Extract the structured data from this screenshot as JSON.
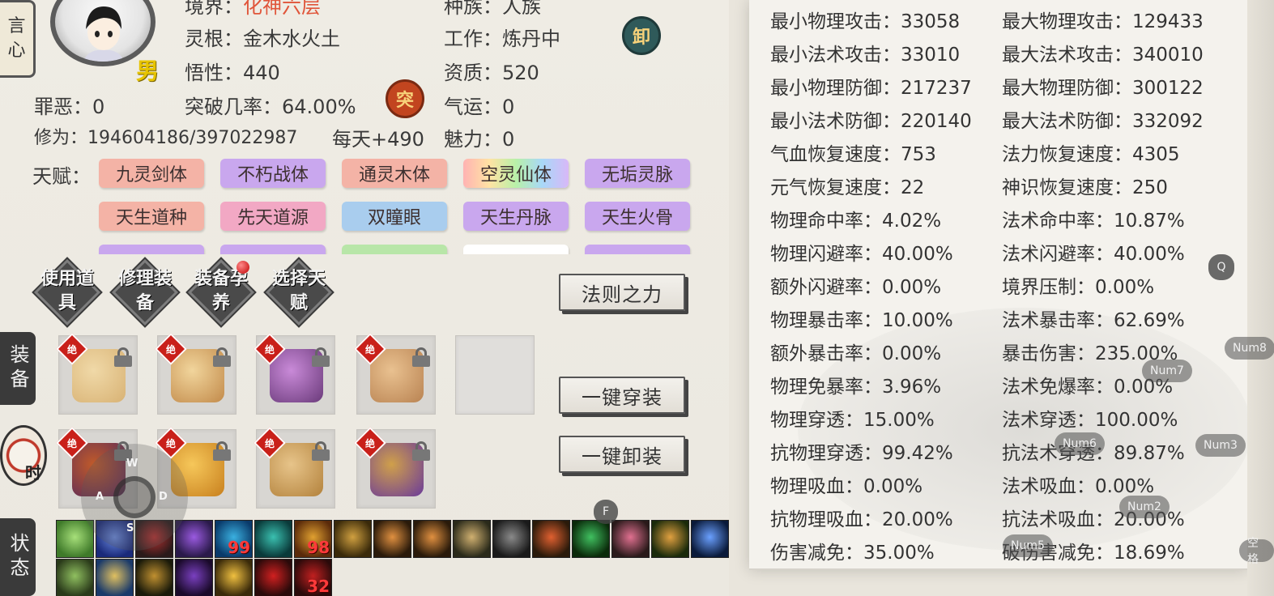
{
  "character": {
    "realm_label": "境界：",
    "realm_value": "化神六层",
    "race_label": "种族：",
    "race_value": "人族",
    "root_label": "灵根：",
    "root_value": "金木水火土",
    "job_label": "工作：",
    "job_value": "炼丹中",
    "insight_label": "悟性：",
    "insight_value": "440",
    "aptitude_label": "资质：",
    "aptitude_value": "520",
    "gender": "男",
    "sin_label": "罪恶：",
    "sin_value": "0",
    "breakthrough_label": "突破几率：",
    "breakthrough_value": "64.00%",
    "luck_label": "气运：",
    "luck_value": "0",
    "cultivation_label": "修为：",
    "cultivation_value": "194604186/397022987",
    "daily_label": "每天+",
    "daily_value": "490",
    "charm_label": "魅力：",
    "charm_value": "0",
    "unequip_badge": "卸",
    "breakthrough_badge": "突"
  },
  "talents": {
    "label": "天赋：",
    "items": [
      {
        "name": "九灵剑体",
        "color": "#f4b3a6"
      },
      {
        "name": "不朽战体",
        "color": "#c9a7ee"
      },
      {
        "name": "通灵木体",
        "color": "#f4b3a6"
      },
      {
        "name": "空灵仙体",
        "color": "rainbow"
      },
      {
        "name": "无垢灵脉",
        "color": "#c9a7ee"
      },
      {
        "name": "天生道种",
        "color": "#f4b3a6"
      },
      {
        "name": "先天道源",
        "color": "#f2a8c4"
      },
      {
        "name": "双瞳眼",
        "color": "#a9cdee"
      },
      {
        "name": "天生丹脉",
        "color": "#c9a7ee"
      },
      {
        "name": "天生火骨",
        "color": "#c9a7ee"
      },
      {
        "name": "",
        "color": "#c9a7ee"
      },
      {
        "name": "",
        "color": "#c9a7ee"
      },
      {
        "name": "",
        "color": "#b8e6a8"
      },
      {
        "name": "",
        "color": "#ffffff"
      },
      {
        "name": "",
        "color": "#c9a7ee"
      }
    ]
  },
  "actions": {
    "use_item": "使用道具",
    "repair_equipment": "修理装备",
    "nurture_equipment": "装备孕养",
    "choose_talent": "选择天赋"
  },
  "buttons": {
    "law_power": "法则之力",
    "equip_all": "一键穿装",
    "unequip_all": "一键卸装"
  },
  "side_tabs": {
    "equipment": "装备",
    "time": "时",
    "status": "状态"
  },
  "equipment": {
    "tier_label": "绝",
    "slots": [
      {
        "item": "robe",
        "colors": [
          "#d8b274",
          "#f0d9a8"
        ]
      },
      {
        "item": "sword",
        "colors": [
          "#c28a4a",
          "#f1d59c"
        ]
      },
      {
        "item": "necklace",
        "colors": [
          "#6a3a7a",
          "#c98ad8"
        ]
      },
      {
        "item": "boots",
        "colors": [
          "#b98352",
          "#e9c190"
        ]
      },
      {
        "item": "empty",
        "colors": []
      },
      {
        "item": "cloak",
        "colors": [
          "#5a2a5a",
          "#c05a2a"
        ]
      },
      {
        "item": "orb",
        "colors": [
          "#c8801e",
          "#f6c75a"
        ]
      },
      {
        "item": "shell",
        "colors": [
          "#b3823c",
          "#e7c48a"
        ]
      },
      {
        "item": "dagger",
        "colors": [
          "#6a3a9a",
          "#d0a04a"
        ]
      }
    ]
  },
  "status_icons": [
    {
      "name": "green-burst",
      "colors": [
        "#3f7a2a",
        "#a7e07a"
      ],
      "num": ""
    },
    {
      "name": "blue-star",
      "colors": [
        "#1a2a7a",
        "#6a8ae0"
      ],
      "num": ""
    },
    {
      "name": "red-demon",
      "colors": [
        "#2a1a1a",
        "#b43030"
      ],
      "num": ""
    },
    {
      "name": "purple-claw",
      "colors": [
        "#2a1a4a",
        "#9a5ae0"
      ],
      "num": ""
    },
    {
      "name": "blue-hand",
      "colors": [
        "#0a3a6a",
        "#3ab0e0"
      ],
      "num": "99"
    },
    {
      "name": "teal-throne",
      "colors": [
        "#0a3a3a",
        "#3ac0b0"
      ],
      "num": ""
    },
    {
      "name": "gold-flame",
      "colors": [
        "#5a2a0a",
        "#e0a030"
      ],
      "num": "98"
    },
    {
      "name": "gold-coin",
      "colors": [
        "#3a2a0a",
        "#d0a040"
      ],
      "num": ""
    },
    {
      "name": "phoenix-a",
      "colors": [
        "#2a1a0a",
        "#e09040"
      ],
      "num": ""
    },
    {
      "name": "phoenix-b",
      "colors": [
        "#2a1a0a",
        "#e09040"
      ],
      "num": ""
    },
    {
      "name": "yin-yang",
      "colors": [
        "#2a2a1a",
        "#d0b070"
      ],
      "num": ""
    },
    {
      "name": "gray-idol",
      "colors": [
        "#1a1a1a",
        "#8a8a8a"
      ],
      "num": ""
    },
    {
      "name": "red-pill",
      "colors": [
        "#2a1a0a",
        "#e06030"
      ],
      "num": ""
    },
    {
      "name": "green-pill",
      "colors": [
        "#0a2a0a",
        "#40c060"
      ],
      "num": ""
    },
    {
      "name": "pink-cauldron",
      "colors": [
        "#2a1a1a",
        "#e07090"
      ],
      "num": ""
    },
    {
      "name": "lotus",
      "colors": [
        "#1a2a0a",
        "#e0a040"
      ],
      "num": ""
    },
    {
      "name": "blue-ring",
      "colors": [
        "#0a1a3a",
        "#6aa0ff"
      ],
      "num": ""
    },
    {
      "name": "green-flower",
      "colors": [
        "#2a3a1a",
        "#90c060"
      ],
      "num": ""
    },
    {
      "name": "gold-scroll",
      "colors": [
        "#1a3a6a",
        "#e0c060"
      ],
      "num": ""
    },
    {
      "name": "gold-buddha",
      "colors": [
        "#1a1a0a",
        "#c09030"
      ],
      "num": ""
    },
    {
      "name": "purple-wolf",
      "colors": [
        "#1a0a2a",
        "#7a40c0"
      ],
      "num": ""
    },
    {
      "name": "gold-lotus",
      "colors": [
        "#3a2a0a",
        "#f0c040"
      ],
      "num": ""
    },
    {
      "name": "red-bird",
      "colors": [
        "#2a0a0a",
        "#d02020"
      ],
      "num": ""
    },
    {
      "name": "red-rose",
      "colors": [
        "#2a0a0a",
        "#c02020"
      ],
      "num": "32"
    }
  ],
  "stats": [
    [
      "最小物理攻击：33058",
      "最大物理攻击：129433"
    ],
    [
      "最小法术攻击：33010",
      "最大法术攻击：340010"
    ],
    [
      "最小物理防御：217237",
      "最大物理防御：300122"
    ],
    [
      "最小法术防御：220140",
      "最大法术防御：332092"
    ],
    [
      "气血恢复速度：753",
      "法力恢复速度：4305"
    ],
    [
      "元气恢复速度：22",
      "神识恢复速度：250"
    ],
    [
      "物理命中率：4.02%",
      "法术命中率：10.87%"
    ],
    [
      "物理闪避率：40.00%",
      "法术闪避率：40.00%"
    ],
    [
      "额外闪避率：0.00%",
      "境界压制：0.00%"
    ],
    [
      "物理暴击率：10.00%",
      "法术暴击率：62.69%"
    ],
    [
      "额外暴击率：0.00%",
      "暴击伤害：235.00%"
    ],
    [
      "物理免暴率：3.96%",
      "法术免爆率：0.00%"
    ],
    [
      "物理穿透：15.00%",
      "法术穿透：100.00%"
    ],
    [
      "抗物理穿透：99.42%",
      "抗法术穿透：89.87%"
    ],
    [
      "物理吸血：0.00%",
      "法术吸血：0.00%"
    ],
    [
      "抗物理吸血：20.00%",
      "抗法术吸血：20.00%"
    ],
    [
      "伤害减免：35.00%",
      "破伤害减免：18.69%"
    ]
  ],
  "overlay_keys": {
    "q": "Q",
    "num8": "Num8",
    "num7": "Num7",
    "num6": "Num6",
    "num3": "Num3",
    "num2": "Num2",
    "num5": "Num5",
    "space": "空格",
    "f": "F",
    "w": "W",
    "a": "A",
    "s": "S",
    "d": "D"
  }
}
